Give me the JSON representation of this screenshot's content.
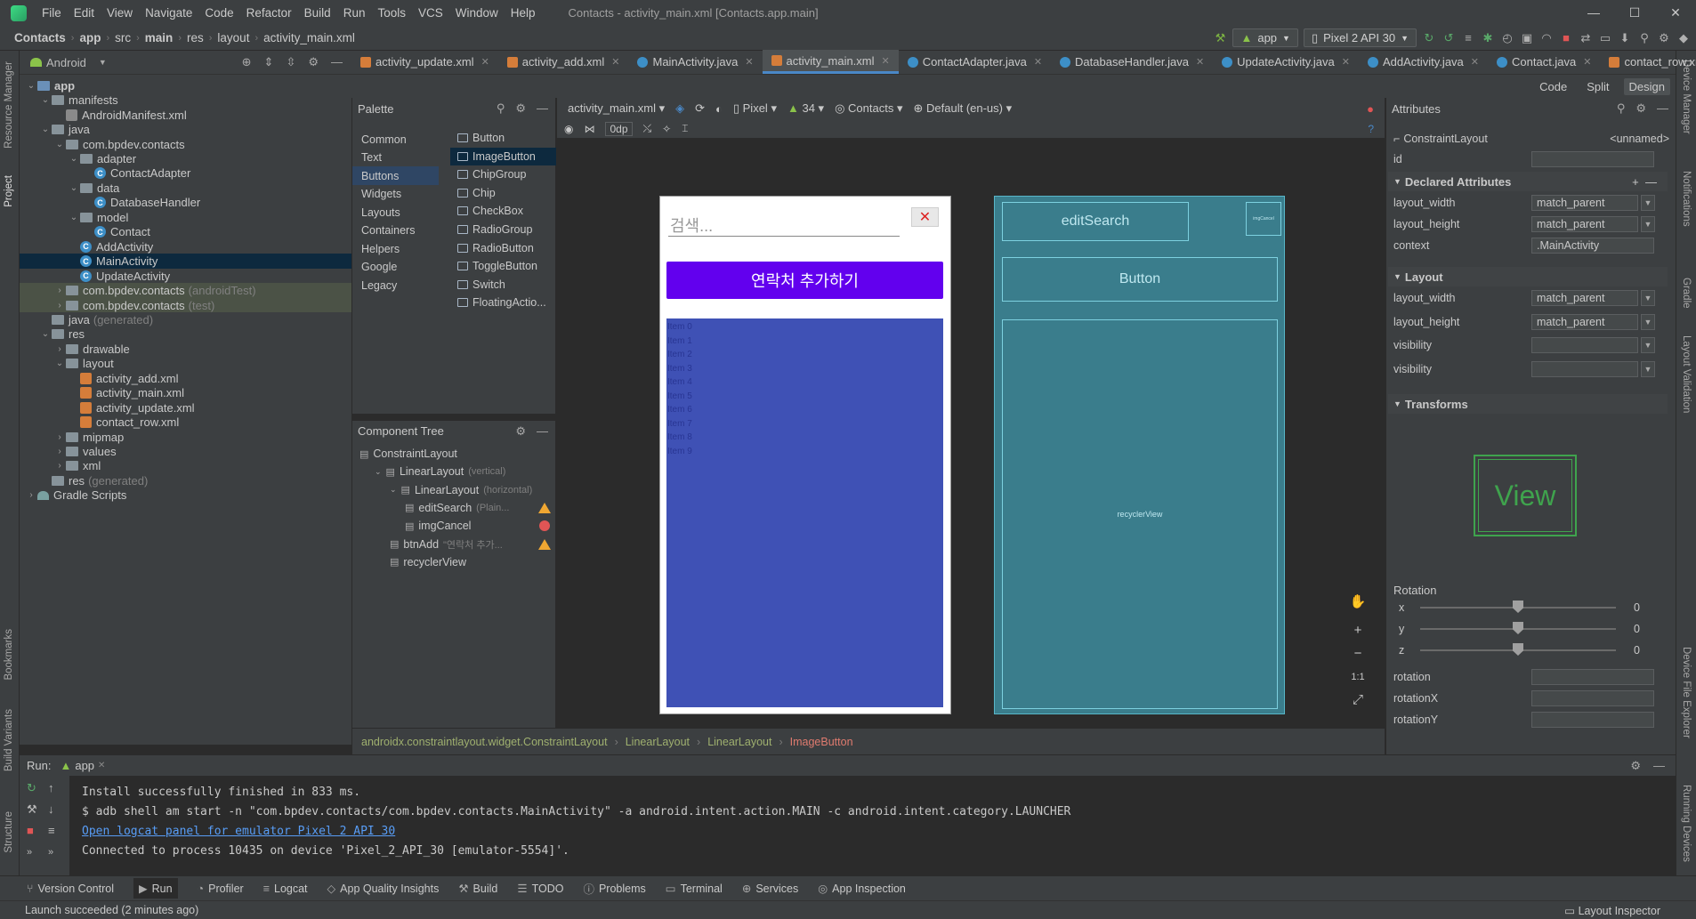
{
  "menu": [
    "File",
    "Edit",
    "View",
    "Navigate",
    "Code",
    "Refactor",
    "Build",
    "Run",
    "Tools",
    "VCS",
    "Window",
    "Help"
  ],
  "window_title": "Contacts - activity_main.xml [Contacts.app.main]",
  "breadcrumb": [
    "Contacts",
    "app",
    "src",
    "main",
    "res",
    "layout",
    "activity_main.xml"
  ],
  "run_config": "app",
  "device": "Pixel 2 API 30",
  "project": {
    "view": "Android",
    "tree": [
      {
        "label": "app",
        "depth": 0,
        "type": "folder-blue",
        "open": true
      },
      {
        "label": "manifests",
        "depth": 1,
        "type": "folder",
        "open": true
      },
      {
        "label": "AndroidManifest.xml",
        "depth": 2,
        "type": "manifest"
      },
      {
        "label": "java",
        "depth": 1,
        "type": "folder",
        "open": true
      },
      {
        "label": "com.bpdev.contacts",
        "depth": 2,
        "type": "pkg",
        "open": true
      },
      {
        "label": "adapter",
        "depth": 3,
        "type": "pkg",
        "open": true
      },
      {
        "label": "ContactAdapter",
        "depth": 4,
        "type": "class"
      },
      {
        "label": "data",
        "depth": 3,
        "type": "pkg",
        "open": true
      },
      {
        "label": "DatabaseHandler",
        "depth": 4,
        "type": "class"
      },
      {
        "label": "model",
        "depth": 3,
        "type": "pkg",
        "open": true
      },
      {
        "label": "Contact",
        "depth": 4,
        "type": "class"
      },
      {
        "label": "AddActivity",
        "depth": 3,
        "type": "class"
      },
      {
        "label": "MainActivity",
        "depth": 3,
        "type": "class",
        "selected": true
      },
      {
        "label": "UpdateActivity",
        "depth": 3,
        "type": "class"
      },
      {
        "label": "com.bpdev.contacts",
        "suffix": "(androidTest)",
        "depth": 2,
        "type": "pkg",
        "closed": true,
        "hl": true
      },
      {
        "label": "com.bpdev.contacts",
        "suffix": "(test)",
        "depth": 2,
        "type": "pkg",
        "closed": true,
        "hl": true
      },
      {
        "label": "java",
        "suffix": "(generated)",
        "depth": 1,
        "type": "folder"
      },
      {
        "label": "res",
        "depth": 1,
        "type": "folder",
        "open": true
      },
      {
        "label": "drawable",
        "depth": 2,
        "type": "folder",
        "closed": true
      },
      {
        "label": "layout",
        "depth": 2,
        "type": "folder",
        "open": true
      },
      {
        "label": "activity_add.xml",
        "depth": 3,
        "type": "xml"
      },
      {
        "label": "activity_main.xml",
        "depth": 3,
        "type": "xml"
      },
      {
        "label": "activity_update.xml",
        "depth": 3,
        "type": "xml"
      },
      {
        "label": "contact_row.xml",
        "depth": 3,
        "type": "xml"
      },
      {
        "label": "mipmap",
        "depth": 2,
        "type": "folder",
        "closed": true
      },
      {
        "label": "values",
        "depth": 2,
        "type": "folder",
        "closed": true
      },
      {
        "label": "xml",
        "depth": 2,
        "type": "folder",
        "closed": true
      },
      {
        "label": "res",
        "suffix": "(generated)",
        "depth": 1,
        "type": "folder"
      },
      {
        "label": "Gradle Scripts",
        "depth": 0,
        "type": "gradle",
        "closed": true
      }
    ]
  },
  "tabs": [
    {
      "label": "activity_update.xml",
      "type": "xml"
    },
    {
      "label": "activity_add.xml",
      "type": "xml"
    },
    {
      "label": "MainActivity.java",
      "type": "java"
    },
    {
      "label": "activity_main.xml",
      "type": "xml",
      "active": true
    },
    {
      "label": "ContactAdapter.java",
      "type": "java"
    },
    {
      "label": "DatabaseHandler.java",
      "type": "java"
    },
    {
      "label": "UpdateActivity.java",
      "type": "java"
    },
    {
      "label": "AddActivity.java",
      "type": "java"
    },
    {
      "label": "Contact.java",
      "type": "java"
    },
    {
      "label": "contact_row.xml",
      "type": "xml"
    }
  ],
  "modes": {
    "code": "Code",
    "split": "Split",
    "design": "Design"
  },
  "palette": {
    "title": "Palette",
    "categories": [
      "Common",
      "Text",
      "Buttons",
      "Widgets",
      "Layouts",
      "Containers",
      "Helpers",
      "Google",
      "Legacy"
    ],
    "selected_category": "Buttons",
    "widgets": [
      "Button",
      "ImageButton",
      "ChipGroup",
      "Chip",
      "CheckBox",
      "RadioGroup",
      "RadioButton",
      "ToggleButton",
      "Switch",
      "FloatingActio..."
    ],
    "selected_widget": "ImageButton"
  },
  "component_tree": {
    "title": "Component Tree",
    "items": [
      {
        "label": "ConstraintLayout",
        "depth": 0
      },
      {
        "label": "LinearLayout",
        "hint": "(vertical)",
        "depth": 1
      },
      {
        "label": "LinearLayout",
        "hint": "(horizontal)",
        "depth": 2
      },
      {
        "label": "editSearch",
        "hint": "(Plain...",
        "depth": 3,
        "status": "warn"
      },
      {
        "label": "imgCancel",
        "hint": "",
        "depth": 3,
        "status": "error"
      },
      {
        "label": "btnAdd",
        "hint": "\"연락처 추가...",
        "depth": 2,
        "status": "warn"
      },
      {
        "label": "recyclerView",
        "hint": "",
        "depth": 2
      }
    ]
  },
  "design_toolbar": {
    "file": "activity_main.xml",
    "device": "Pixel",
    "api": "34",
    "theme": "Contacts",
    "locale": "Default (en-us)",
    "margin": "0dp"
  },
  "preview": {
    "search_hint": "검색...",
    "cancel_glyph": "✕",
    "add_button": "연락처 추가하기",
    "items": [
      "Item 0",
      "Item 1",
      "Item 2",
      "Item 3",
      "Item 4",
      "Item 5",
      "Item 6",
      "Item 7",
      "Item 8",
      "Item 9"
    ]
  },
  "blueprint": {
    "edit": "editSearch",
    "cancel": "imgCancel",
    "button": "Button",
    "recycler": "recyclerView"
  },
  "zoom": {
    "fit": "1:1"
  },
  "design_breadcrumb": [
    "androidx.constraintlayout.widget.ConstraintLayout",
    "LinearLayout",
    "LinearLayout",
    "ImageButton"
  ],
  "attributes": {
    "title": "Attributes",
    "component": "ConstraintLayout",
    "name": "<unnamed>",
    "id_label": "id",
    "declared_title": "Declared Attributes",
    "declared": [
      {
        "name": "layout_width",
        "value": "match_parent"
      },
      {
        "name": "layout_height",
        "value": "match_parent"
      },
      {
        "name": "context",
        "value": ".MainActivity"
      }
    ],
    "layout_title": "Layout",
    "layout": [
      {
        "name": "layout_width",
        "value": "match_parent"
      },
      {
        "name": "layout_height",
        "value": "match_parent"
      },
      {
        "name": "visibility",
        "value": ""
      },
      {
        "name": "visibility",
        "value": ""
      }
    ],
    "transforms_title": "Transforms",
    "view_label": "View",
    "rotation_label": "Rotation",
    "rotation_axes": [
      {
        "axis": "x",
        "value": "0"
      },
      {
        "axis": "y",
        "value": "0"
      },
      {
        "axis": "z",
        "value": "0"
      }
    ],
    "extra": [
      "rotation",
      "rotationX",
      "rotationY"
    ]
  },
  "run": {
    "label": "Run:",
    "config": "app",
    "lines": [
      {
        "text": "Install successfully finished in 833 ms.",
        "link": false
      },
      {
        "text": "$ adb shell am start -n \"com.bpdev.contacts/com.bpdev.contacts.MainActivity\" -a android.intent.action.MAIN -c android.intent.category.LAUNCHER",
        "link": false
      },
      {
        "text": "Open logcat panel for emulator Pixel 2 API 30",
        "link": true
      },
      {
        "text": "Connected to process 10435 on device 'Pixel_2_API_30 [emulator-5554]'.",
        "link": false
      }
    ]
  },
  "bottom_tools": [
    "Version Control",
    "Run",
    "Profiler",
    "Logcat",
    "App Quality Insights",
    "Build",
    "TODO",
    "Problems",
    "Terminal",
    "Services",
    "App Inspection"
  ],
  "layout_inspector": "Layout Inspector",
  "status": "Launch succeeded (2 minutes ago)",
  "left_stripe": [
    "Resource Manager",
    "Project",
    "Bookmarks",
    "Build Variants",
    "Structure"
  ],
  "right_stripe": [
    "Device Manager",
    "Notifications",
    "Gradle",
    "Layout Validation",
    "Device File Explorer",
    "Running Devices"
  ]
}
